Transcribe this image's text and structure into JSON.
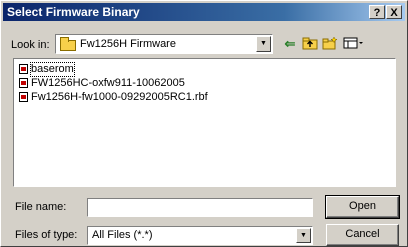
{
  "window": {
    "title": "Select Firmware Binary",
    "help_label": "?",
    "close_label": "X"
  },
  "lookin": {
    "label": "Look in:",
    "value": "Fw1256H Firmware",
    "dropdown_arrow": "▼"
  },
  "toolbar": {
    "back_icon": "⇐",
    "up_icon": "up-folder-icon",
    "new_folder_icon": "new-folder-icon",
    "view_menu_icon": "view-menu-icon"
  },
  "files": [
    {
      "name": "baserom",
      "selected": true
    },
    {
      "name": "FW1256HC-oxfw911-10062005",
      "selected": false
    },
    {
      "name": "Fw1256H-fw1000-09292005RC1.rbf",
      "selected": false
    }
  ],
  "file_name": {
    "label": "File name:",
    "value": ""
  },
  "file_type": {
    "label": "Files of type:",
    "value": "All Files (*.*)",
    "dropdown_arrow": "▼"
  },
  "buttons": {
    "open": "Open",
    "cancel": "Cancel"
  }
}
